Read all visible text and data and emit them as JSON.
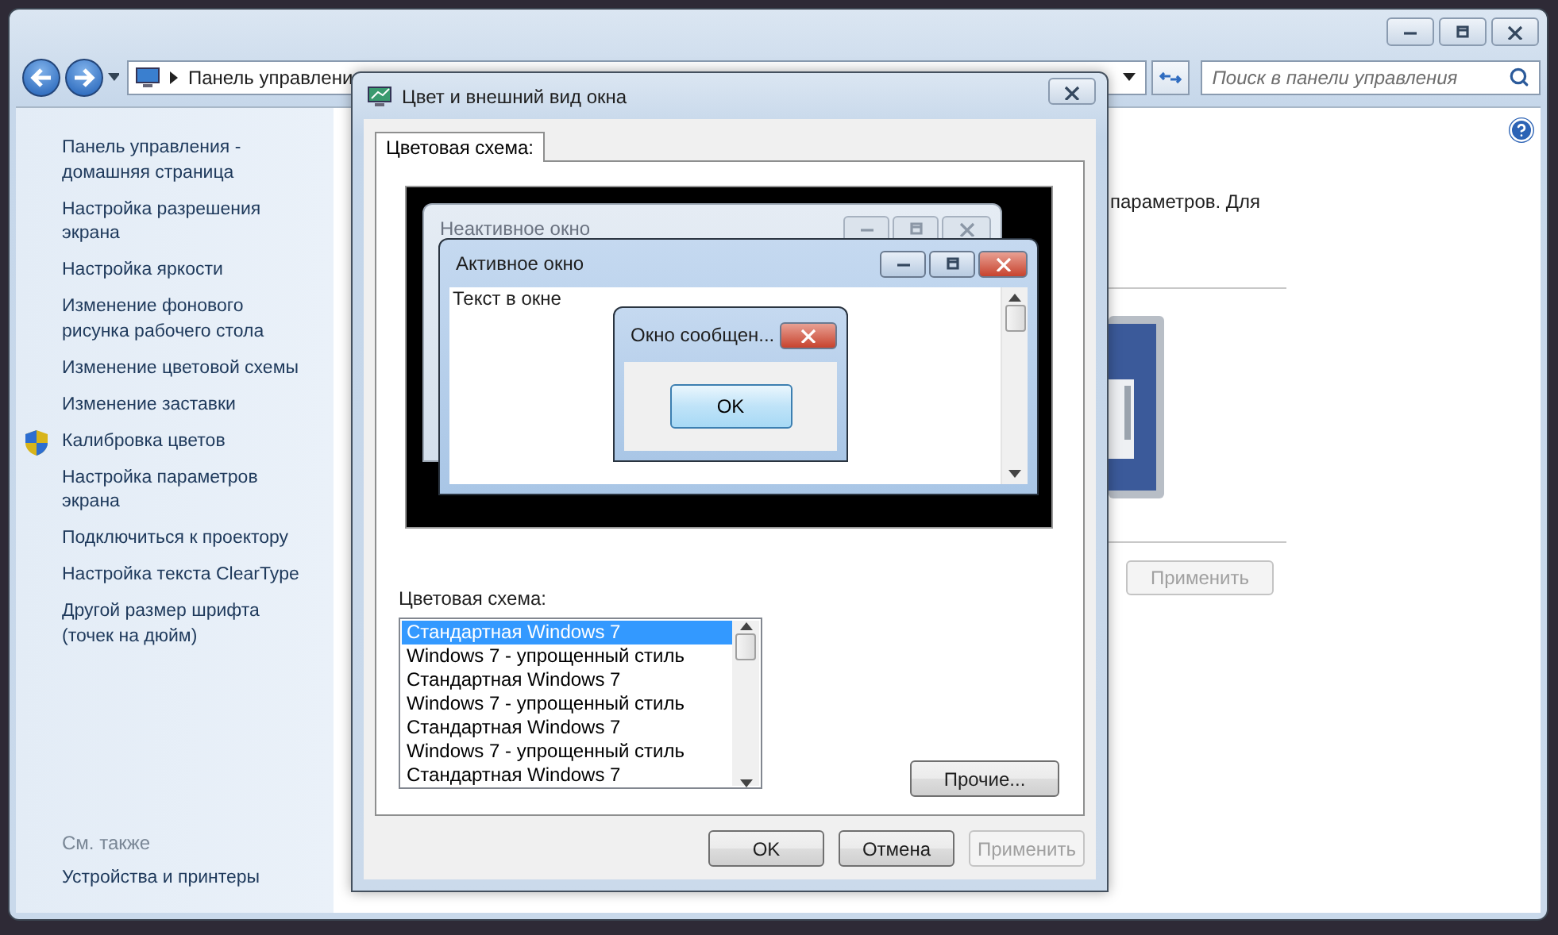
{
  "navigation": {
    "address": "Панель управлени",
    "search": {
      "placeholder": "Поиск в панели управления"
    }
  },
  "sidebar": {
    "items": [
      {
        "label": "Панель управления - домашняя страница",
        "kind": "link"
      },
      {
        "label": "Настройка разрешения экрана",
        "kind": "link"
      },
      {
        "label": "Настройка яркости",
        "kind": "link"
      },
      {
        "label": "Изменение фонового рисунка рабочего стола",
        "kind": "link"
      },
      {
        "label": "Изменение цветовой схемы",
        "kind": "link"
      },
      {
        "label": "Изменение заставки",
        "kind": "link"
      },
      {
        "label": "Калибровка цветов",
        "kind": "shield"
      },
      {
        "label": "Настройка параметров экрана",
        "kind": "link"
      },
      {
        "label": "Подключиться к проектору",
        "kind": "link"
      },
      {
        "label": "Настройка текста ClearType",
        "kind": "link"
      },
      {
        "label": "Другой размер шрифта (точек на дюйм)",
        "kind": "link"
      }
    ],
    "see_also": {
      "heading": "См. также",
      "items": [
        {
          "label": "Устройства и принтеры"
        }
      ]
    }
  },
  "content": {
    "text": "параметров. Для",
    "apply_button": {
      "label": "Применить",
      "disabled": true
    }
  },
  "dialog": {
    "title": "Цвет и внешний вид окна",
    "tabs": [
      {
        "label": "Цветовая схема:",
        "selected": true
      }
    ],
    "preview": {
      "windows": [
        {
          "kind": "inactive",
          "title": "Неактивное окно"
        },
        {
          "kind": "active",
          "title": "Активное окно",
          "text": "Текст в окне"
        },
        {
          "kind": "message",
          "title": "Окно сообщен...",
          "button": "OK"
        }
      ]
    },
    "scheme_label": "Цветовая схема:",
    "schemes": [
      {
        "label": "Стандартная Windows 7",
        "selected": true
      },
      {
        "label": "Windows 7 - упрощенный стиль",
        "selected": false
      },
      {
        "label": "Стандартная Windows 7",
        "selected": false
      },
      {
        "label": "Windows 7 - упрощенный стиль",
        "selected": false
      },
      {
        "label": "Стандартная Windows 7",
        "selected": false
      },
      {
        "label": "Windows 7 - упрощенный стиль",
        "selected": false
      },
      {
        "label": "Стандартная Windows 7",
        "selected": false
      }
    ],
    "other_button": {
      "label": "Прочие...",
      "disabled": false
    },
    "buttons": [
      {
        "label": "OK",
        "disabled": false
      },
      {
        "label": "Отмена",
        "disabled": false
      },
      {
        "label": "Применить",
        "disabled": true
      }
    ]
  }
}
